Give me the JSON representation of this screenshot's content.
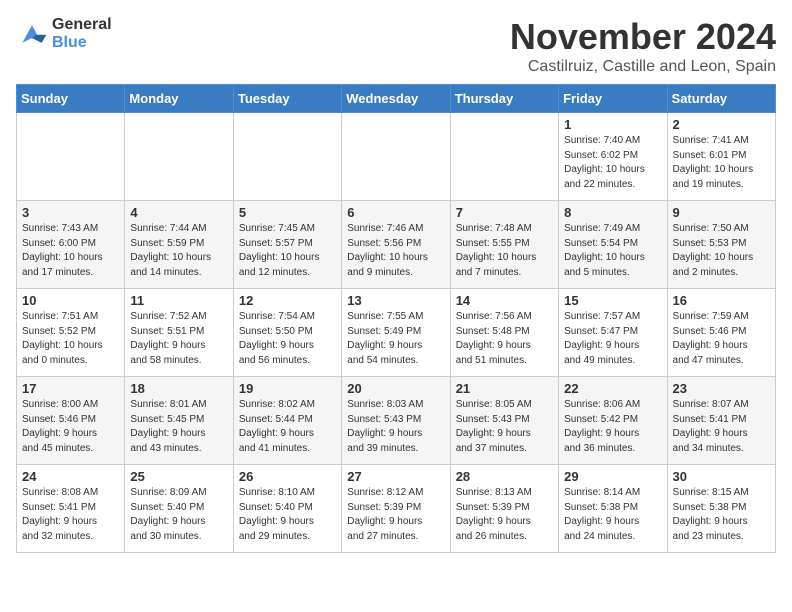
{
  "logo": {
    "line1": "General",
    "line2": "Blue"
  },
  "title": "November 2024",
  "location": "Castilruiz, Castille and Leon, Spain",
  "weekdays": [
    "Sunday",
    "Monday",
    "Tuesday",
    "Wednesday",
    "Thursday",
    "Friday",
    "Saturday"
  ],
  "weeks": [
    [
      {
        "day": "",
        "info": ""
      },
      {
        "day": "",
        "info": ""
      },
      {
        "day": "",
        "info": ""
      },
      {
        "day": "",
        "info": ""
      },
      {
        "day": "",
        "info": ""
      },
      {
        "day": "1",
        "info": "Sunrise: 7:40 AM\nSunset: 6:02 PM\nDaylight: 10 hours\nand 22 minutes."
      },
      {
        "day": "2",
        "info": "Sunrise: 7:41 AM\nSunset: 6:01 PM\nDaylight: 10 hours\nand 19 minutes."
      }
    ],
    [
      {
        "day": "3",
        "info": "Sunrise: 7:43 AM\nSunset: 6:00 PM\nDaylight: 10 hours\nand 17 minutes."
      },
      {
        "day": "4",
        "info": "Sunrise: 7:44 AM\nSunset: 5:59 PM\nDaylight: 10 hours\nand 14 minutes."
      },
      {
        "day": "5",
        "info": "Sunrise: 7:45 AM\nSunset: 5:57 PM\nDaylight: 10 hours\nand 12 minutes."
      },
      {
        "day": "6",
        "info": "Sunrise: 7:46 AM\nSunset: 5:56 PM\nDaylight: 10 hours\nand 9 minutes."
      },
      {
        "day": "7",
        "info": "Sunrise: 7:48 AM\nSunset: 5:55 PM\nDaylight: 10 hours\nand 7 minutes."
      },
      {
        "day": "8",
        "info": "Sunrise: 7:49 AM\nSunset: 5:54 PM\nDaylight: 10 hours\nand 5 minutes."
      },
      {
        "day": "9",
        "info": "Sunrise: 7:50 AM\nSunset: 5:53 PM\nDaylight: 10 hours\nand 2 minutes."
      }
    ],
    [
      {
        "day": "10",
        "info": "Sunrise: 7:51 AM\nSunset: 5:52 PM\nDaylight: 10 hours\nand 0 minutes."
      },
      {
        "day": "11",
        "info": "Sunrise: 7:52 AM\nSunset: 5:51 PM\nDaylight: 9 hours\nand 58 minutes."
      },
      {
        "day": "12",
        "info": "Sunrise: 7:54 AM\nSunset: 5:50 PM\nDaylight: 9 hours\nand 56 minutes."
      },
      {
        "day": "13",
        "info": "Sunrise: 7:55 AM\nSunset: 5:49 PM\nDaylight: 9 hours\nand 54 minutes."
      },
      {
        "day": "14",
        "info": "Sunrise: 7:56 AM\nSunset: 5:48 PM\nDaylight: 9 hours\nand 51 minutes."
      },
      {
        "day": "15",
        "info": "Sunrise: 7:57 AM\nSunset: 5:47 PM\nDaylight: 9 hours\nand 49 minutes."
      },
      {
        "day": "16",
        "info": "Sunrise: 7:59 AM\nSunset: 5:46 PM\nDaylight: 9 hours\nand 47 minutes."
      }
    ],
    [
      {
        "day": "17",
        "info": "Sunrise: 8:00 AM\nSunset: 5:46 PM\nDaylight: 9 hours\nand 45 minutes."
      },
      {
        "day": "18",
        "info": "Sunrise: 8:01 AM\nSunset: 5:45 PM\nDaylight: 9 hours\nand 43 minutes."
      },
      {
        "day": "19",
        "info": "Sunrise: 8:02 AM\nSunset: 5:44 PM\nDaylight: 9 hours\nand 41 minutes."
      },
      {
        "day": "20",
        "info": "Sunrise: 8:03 AM\nSunset: 5:43 PM\nDaylight: 9 hours\nand 39 minutes."
      },
      {
        "day": "21",
        "info": "Sunrise: 8:05 AM\nSunset: 5:43 PM\nDaylight: 9 hours\nand 37 minutes."
      },
      {
        "day": "22",
        "info": "Sunrise: 8:06 AM\nSunset: 5:42 PM\nDaylight: 9 hours\nand 36 minutes."
      },
      {
        "day": "23",
        "info": "Sunrise: 8:07 AM\nSunset: 5:41 PM\nDaylight: 9 hours\nand 34 minutes."
      }
    ],
    [
      {
        "day": "24",
        "info": "Sunrise: 8:08 AM\nSunset: 5:41 PM\nDaylight: 9 hours\nand 32 minutes."
      },
      {
        "day": "25",
        "info": "Sunrise: 8:09 AM\nSunset: 5:40 PM\nDaylight: 9 hours\nand 30 minutes."
      },
      {
        "day": "26",
        "info": "Sunrise: 8:10 AM\nSunset: 5:40 PM\nDaylight: 9 hours\nand 29 minutes."
      },
      {
        "day": "27",
        "info": "Sunrise: 8:12 AM\nSunset: 5:39 PM\nDaylight: 9 hours\nand 27 minutes."
      },
      {
        "day": "28",
        "info": "Sunrise: 8:13 AM\nSunset: 5:39 PM\nDaylight: 9 hours\nand 26 minutes."
      },
      {
        "day": "29",
        "info": "Sunrise: 8:14 AM\nSunset: 5:38 PM\nDaylight: 9 hours\nand 24 minutes."
      },
      {
        "day": "30",
        "info": "Sunrise: 8:15 AM\nSunset: 5:38 PM\nDaylight: 9 hours\nand 23 minutes."
      }
    ]
  ]
}
